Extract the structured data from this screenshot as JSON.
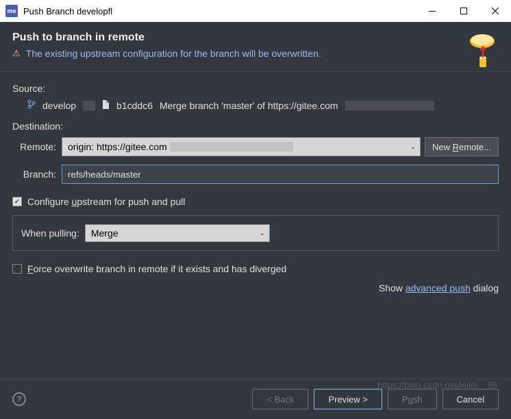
{
  "titlebar": {
    "app_icon": "me",
    "title": "Push Branch developfl"
  },
  "header": {
    "title": "Push to branch in remote",
    "warning": "The existing upstream configuration for the branch will be overwritten."
  },
  "source": {
    "label": "Source:",
    "branch": "develop",
    "commit": "b1cddc6",
    "message": "Merge branch 'master' of https://gitee.com"
  },
  "destination": {
    "label": "Destination:",
    "remote_label": "Remote:",
    "remote_value": "origin: https://gitee.com",
    "new_remote_btn": "New Remote...",
    "branch_label": "Branch:",
    "branch_value": "refs/heads/master"
  },
  "options": {
    "configure_upstream": "Configure upstream for push and pull",
    "when_pulling_label": "When pulling:",
    "when_pulling_value": "Merge",
    "force_overwrite": "Force overwrite branch in remote if it exists and has diverged",
    "advanced_prefix": "Show ",
    "advanced_link": "advanced push",
    "advanced_suffix": " dialog"
  },
  "footer": {
    "back": "< Back",
    "preview": "Preview >",
    "push": "Push",
    "cancel": "Cancel"
  },
  "watermark": "https://blog.csdn.net/leilei__66"
}
